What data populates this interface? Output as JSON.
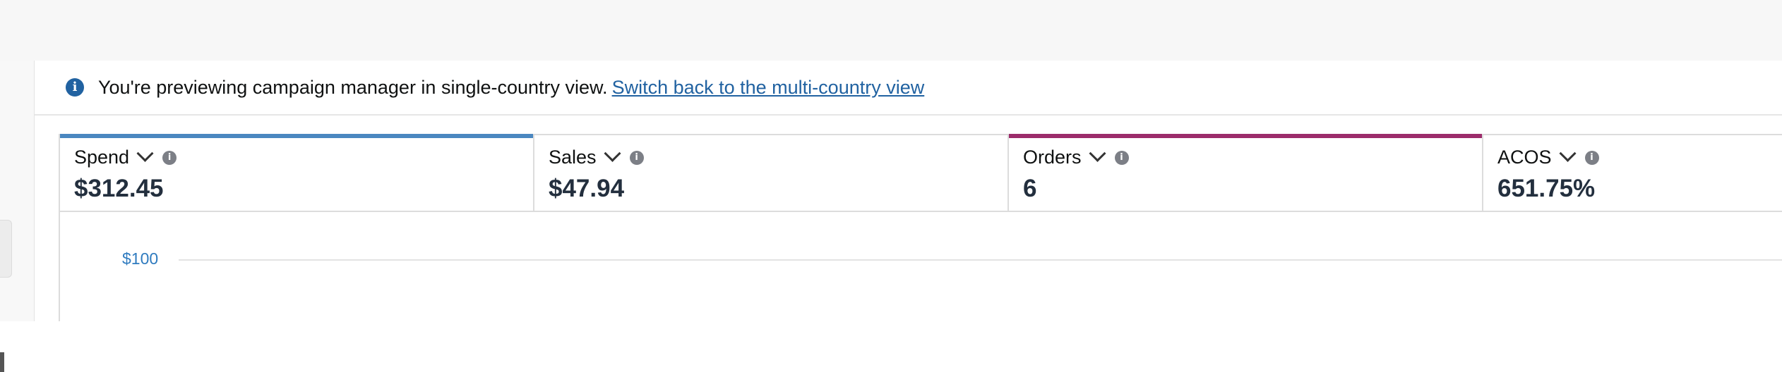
{
  "banner": {
    "message": "You're previewing campaign manager in single-country view.",
    "link_label": "Switch back to the multi-country view"
  },
  "metrics": [
    {
      "label": "Spend",
      "value": "$312.45",
      "accent_color": "#4a87c0",
      "selected": true
    },
    {
      "label": "Sales",
      "value": "$47.94",
      "accent_color": null,
      "selected": false
    },
    {
      "label": "Orders",
      "value": "6",
      "accent_color": "#9c2c6b",
      "selected": true
    },
    {
      "label": "ACOS",
      "value": "651.75%",
      "accent_color": null,
      "selected": false
    }
  ],
  "chart": {
    "y_tick_label": "$100"
  },
  "icons": {
    "info": "info-icon",
    "dropdown": "chevron-down-icon",
    "help": "help-icon"
  },
  "colors": {
    "link": "#2162a1",
    "axis_tick": "#2f7bbf",
    "value_text": "#232f3e"
  }
}
